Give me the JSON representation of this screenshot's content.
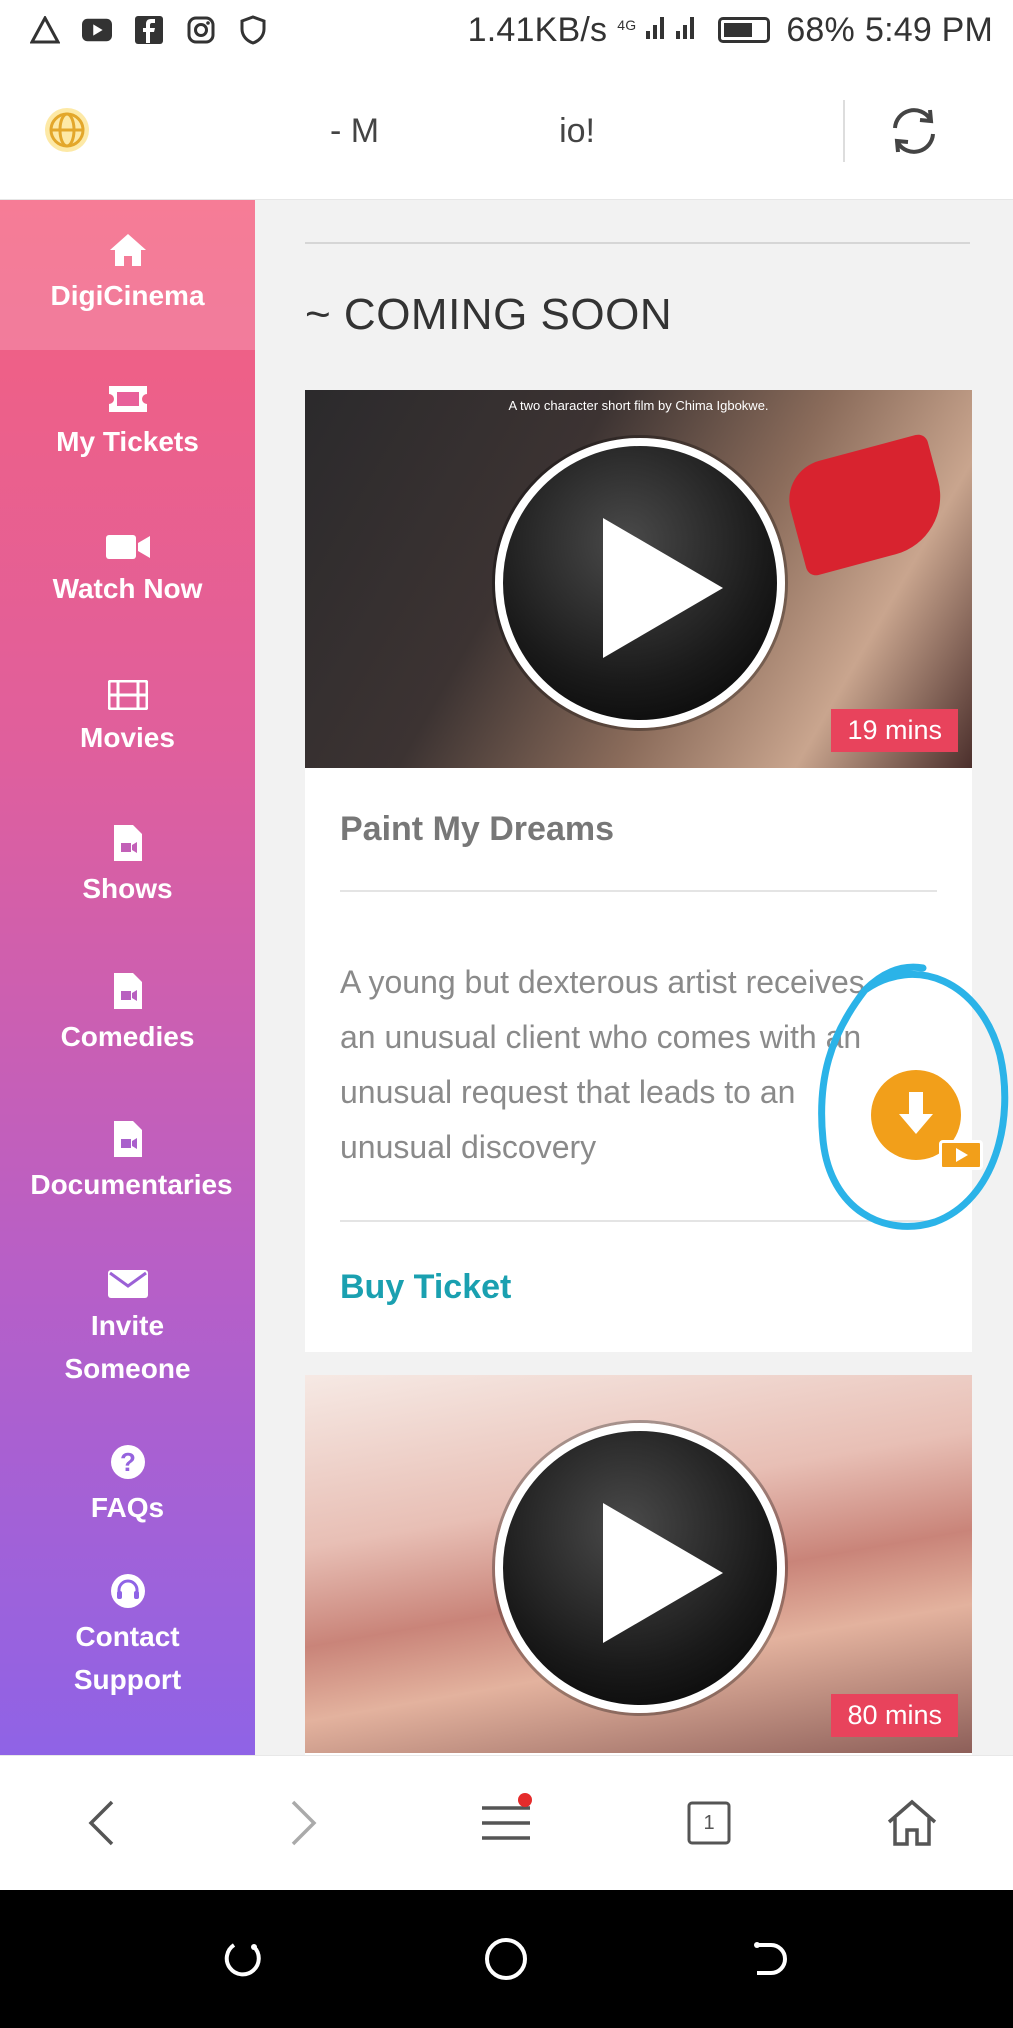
{
  "status_bar": {
    "speed": "1.41KB/s",
    "network": "4G",
    "battery": "68%",
    "time": "5:49 PM",
    "icons": [
      "alert-icon",
      "youtube-icon",
      "facebook-icon",
      "instagram-icon",
      "shield-icon"
    ]
  },
  "browser": {
    "url_left": "- M",
    "url_right": "io!"
  },
  "sidebar": {
    "items": [
      {
        "label": "DigiCinema",
        "icon": "home-icon"
      },
      {
        "label": "My Tickets",
        "icon": "ticket-icon"
      },
      {
        "label": "Watch Now",
        "icon": "video-camera-icon"
      },
      {
        "label": "Movies",
        "icon": "film-icon"
      },
      {
        "label": "Shows",
        "icon": "file-video-icon"
      },
      {
        "label": "Comedies",
        "icon": "file-video-icon"
      },
      {
        "label": "Documentaries",
        "icon": "file-video-icon"
      },
      {
        "label": "Invite Someone",
        "icon": "envelope-icon"
      },
      {
        "label": "FAQs",
        "icon": "question-icon"
      },
      {
        "label": "Contact Support",
        "icon": "headset-icon"
      }
    ]
  },
  "main": {
    "section_title": "~ COMING SOON",
    "cards": [
      {
        "poster_credit": "A two character short film by Chima Igbokwe.",
        "duration": "19 mins",
        "title": "Paint My Dreams",
        "description": "A young but dexterous artist receives an unusual client who comes with an unusual request that leads to an unusual discovery",
        "buy_label": "Buy Ticket"
      },
      {
        "duration": "80 mins"
      }
    ]
  },
  "bottom_nav": {
    "tab_count": "1"
  },
  "colors": {
    "sidebar_top": "#f4607f",
    "sidebar_bottom": "#8f63e6",
    "accent_link": "#1aa0b0",
    "duration_badge": "#e8435c",
    "download_button": "#f29f1a",
    "annotation": "#2bb3e8"
  }
}
